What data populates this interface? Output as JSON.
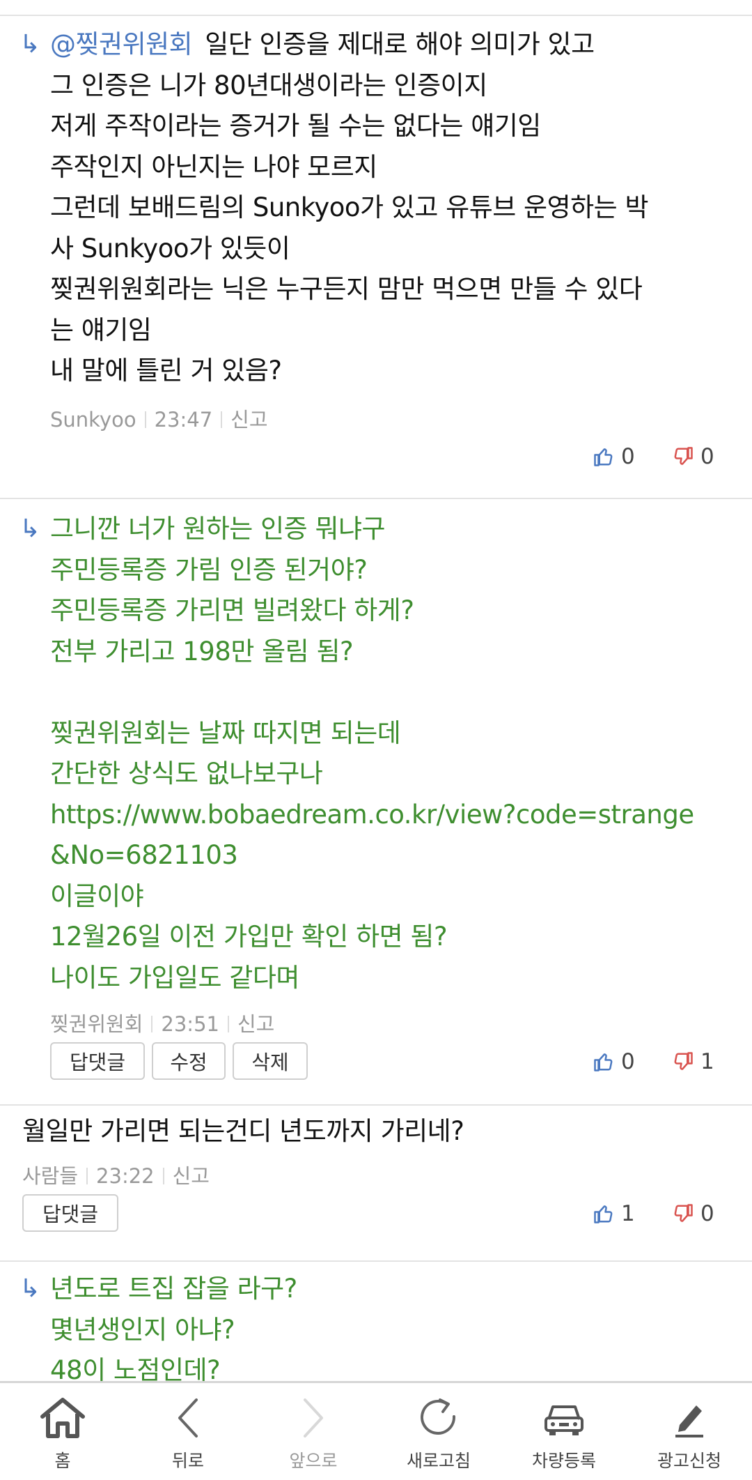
{
  "comments": [
    {
      "reply": true,
      "mention": "@찢권위원회",
      "lines": [
        "일단 인증을 제대로 해야 의미가 있고",
        "그 인증은 니가 80년대생이라는 인증이지",
        "저게 주작이라는 증거가 될 수는 없다는 얘기임",
        "주작인지 아닌지는 나야 모르지",
        "그런데 보배드림의 Sunkyoo가 있고 유튜브 운영하는 박",
        "사 Sunkyoo가 있듯이",
        "찢권위원회라는 닉은 누구든지 맘만 먹으면 만들 수 있다",
        "는 얘기임",
        "내 말에 틀린 거 있음?"
      ],
      "author": "Sunkyoo",
      "time": "23:47",
      "report": "신고",
      "likes": "0",
      "dislikes": "0"
    },
    {
      "reply": true,
      "lines": [
        "그니깐 너가 원하는 인증 뭐냐구",
        "주민등록증 가림 인증 된거야?",
        "주민등록증 가리면 빌려왔다 하게?",
        "전부 가리고 198만 올림 됨?",
        "",
        "찢권위원회는 날짜 따지면 되는데",
        "간단한 상식도 없나보구나",
        "https://www.bobaedream.co.kr/view?code=strange",
        "&No=6821103",
        "이글이야",
        "12월26일 이전 가입만 확인 하면 됨?",
        "나이도 가입일도 같다며"
      ],
      "author": "찢권위원회",
      "time": "23:51",
      "report": "신고",
      "buttons": [
        "답댓글",
        "수정",
        "삭제"
      ],
      "likes": "0",
      "dislikes": "1"
    },
    {
      "reply": false,
      "lines": [
        "월일만 가리면 되는건디 년도까지 가리네?"
      ],
      "author": "사람들",
      "time": "23:22",
      "report": "신고",
      "buttons": [
        "답댓글"
      ],
      "likes": "1",
      "dislikes": "0"
    },
    {
      "reply": true,
      "lines": [
        "년도로 트집 잡을 라구?",
        "몇년생인지 아냐?",
        "48이 노점인데?"
      ]
    }
  ],
  "nav": [
    {
      "label": "홈",
      "icon": "home-icon"
    },
    {
      "label": "뒤로",
      "icon": "back-icon"
    },
    {
      "label": "앞으로",
      "icon": "forward-icon"
    },
    {
      "label": "새로고침",
      "icon": "refresh-icon"
    },
    {
      "label": "차량등록",
      "icon": "car-icon"
    },
    {
      "label": "광고신청",
      "icon": "pen-icon"
    }
  ],
  "colors": {
    "green_text": "#3e8e2f",
    "reply_blue": "#4a78c0",
    "like_blue": "#4a78c0",
    "dislike_red": "#d9534f"
  }
}
